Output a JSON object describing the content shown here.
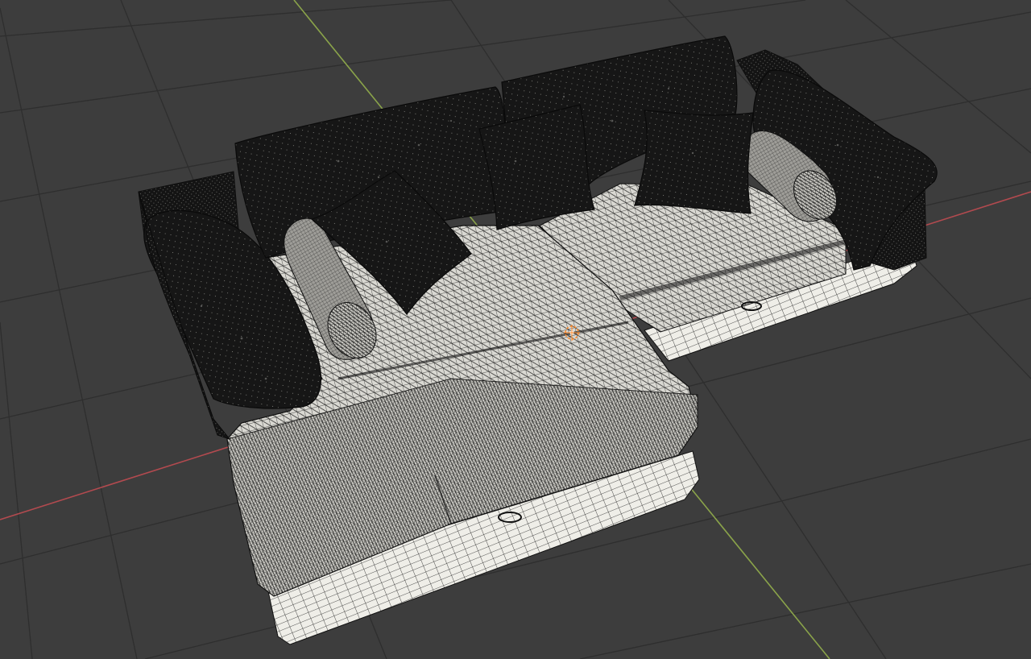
{
  "viewport": {
    "colors": {
      "background": "#3d3d3d",
      "grid_line": "#2e2e2e",
      "x_axis": "#b24a4f",
      "y_axis": "#8aa34a",
      "mesh_light": "#e8e6df",
      "mesh_dark": "#121212",
      "wire": "#000000",
      "origin_marker": "#ff8a2a"
    },
    "object": {
      "kind": "sofa-wireframe-mesh",
      "cushions": 7,
      "bolsters": 2
    }
  }
}
